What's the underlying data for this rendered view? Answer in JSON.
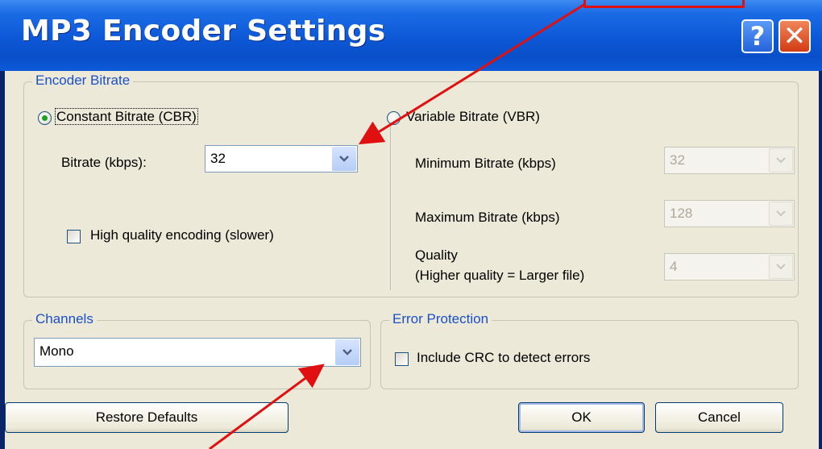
{
  "window": {
    "title": "MP3 Encoder Settings",
    "help_glyph": "?",
    "close_glyph": "✕"
  },
  "encoder_bitrate": {
    "group_label": "Encoder Bitrate",
    "cbr_label": "Constant Bitrate (CBR)",
    "cbr_selected": true,
    "bitrate_label": "Bitrate (kbps):",
    "bitrate_value": "32",
    "high_quality_label": "High quality encoding (slower)",
    "high_quality_checked": false,
    "vbr_label": "Variable Bitrate (VBR)",
    "vbr_selected": false,
    "min_label": "Minimum Bitrate (kbps)",
    "min_value": "32",
    "max_label": "Maximum Bitrate (kbps)",
    "max_value": "128",
    "quality_label_1": "Quality",
    "quality_label_2": "(Higher quality = Larger file)",
    "quality_value": "4"
  },
  "channels": {
    "group_label": "Channels",
    "value": "Mono"
  },
  "error_protection": {
    "group_label": "Error Protection",
    "crc_label": "Include CRC to detect errors",
    "crc_checked": false
  },
  "buttons": {
    "restore": "Restore Defaults",
    "ok": "OK",
    "cancel": "Cancel"
  },
  "colors": {
    "title_bar": "#0c57d6",
    "group_label": "#1a50c8",
    "annotation": "#e01010",
    "dialog_face": "#ece9d8"
  },
  "icons": {
    "dropdown": "chevron-down-icon",
    "help": "help-icon",
    "close": "close-icon"
  }
}
